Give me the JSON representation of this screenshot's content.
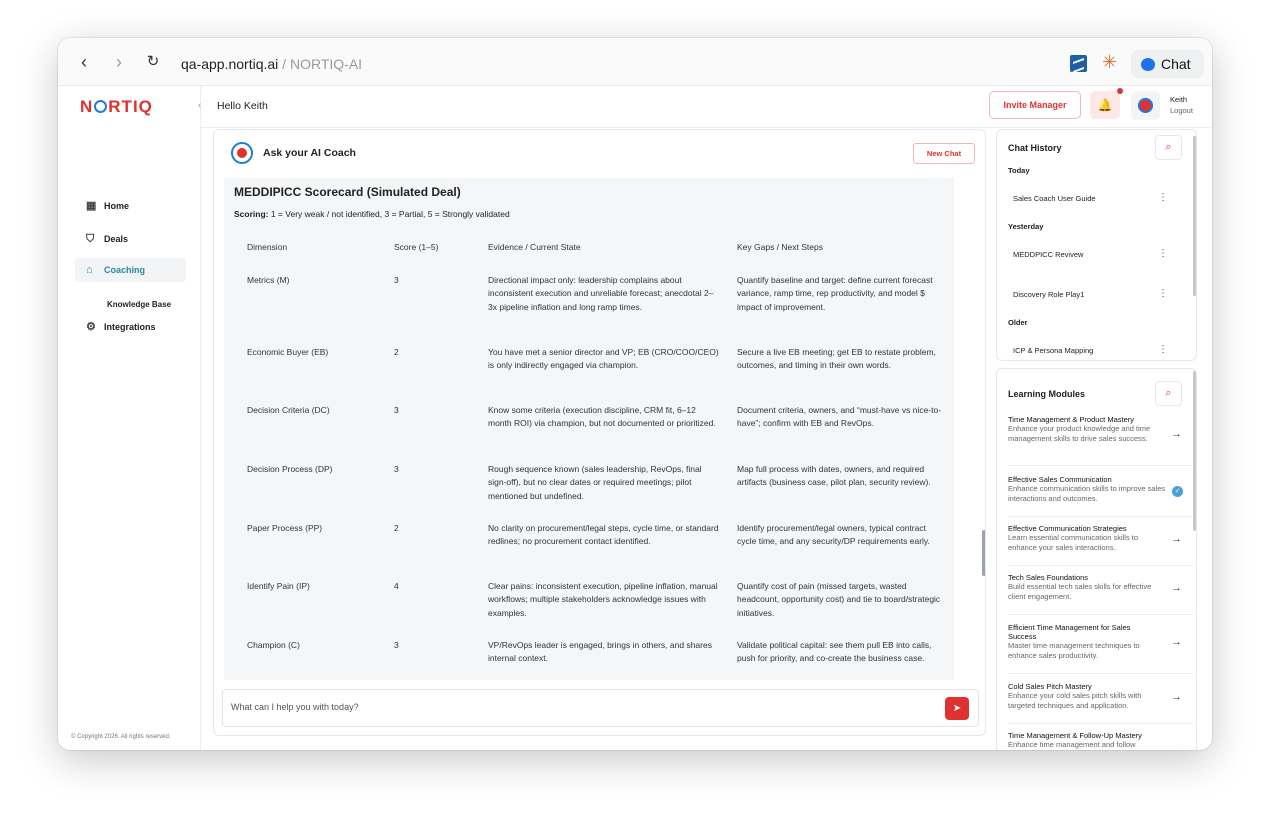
{
  "browser": {
    "url_host": "qa-app.nortiq.ai",
    "url_path": " / NORTIQ-AI",
    "chat_label": "Chat"
  },
  "brand": {
    "logo_pre": "N",
    "logo_post": "RTIQ"
  },
  "sidebar": {
    "items": [
      {
        "label": "Home"
      },
      {
        "label": "Deals"
      },
      {
        "label": "Coaching"
      },
      {
        "label": "Integrations"
      }
    ],
    "sub_item": "Knowledge Base",
    "copyright": "© Copyright 2026. All rights reserved."
  },
  "header": {
    "greeting": "Hello Keith",
    "invite_label": "Invite Manager",
    "user_name": "Keith",
    "logout_label": "Logout"
  },
  "coach": {
    "title": "Ask your AI Coach",
    "new_chat_label": "New Chat",
    "message_title": "MEDDIPICC Scorecard (Simulated Deal)",
    "scoring_label": "Scoring:",
    "scoring_text": " 1 = Very weak / not identified, 3 = Partial, 5 = Strongly validated",
    "table": {
      "headers": [
        "Dimension",
        "Score (1–5)",
        "Evidence / Current State",
        "Key Gaps / Next Steps"
      ],
      "rows": [
        {
          "dimension": "Metrics (M)",
          "score": "3",
          "evidence": "Directional impact only: leadership complains about inconsistent execution and unreliable forecast; anecdotal 2–3x pipeline inflation and long ramp times.",
          "gaps": "Quantify baseline and target: define current forecast variance, ramp time, rep productivity, and model $ impact of improvement."
        },
        {
          "dimension": "Economic Buyer (EB)",
          "score": "2",
          "evidence": "You have met a senior director and VP; EB (CRO/COO/CEO) is only indirectly engaged via champion.",
          "gaps": "Secure a live EB meeting; get EB to restate problem, outcomes, and timing in their own words."
        },
        {
          "dimension": "Decision Criteria (DC)",
          "score": "3",
          "evidence": "Know some criteria (execution discipline, CRM fit, 6–12 month ROI) via champion, but not documented or prioritized.",
          "gaps": "Document criteria, owners, and “must-have vs nice-to-have”; confirm with EB and RevOps."
        },
        {
          "dimension": "Decision Process (DP)",
          "score": "3",
          "evidence": "Rough sequence known (sales leadership, RevOps, final sign-off), but no clear dates or required meetings; pilot mentioned but undefined.",
          "gaps": "Map full process with dates, owners, and required artifacts (business case, pilot plan, security review)."
        },
        {
          "dimension": "Paper Process (PP)",
          "score": "2",
          "evidence": "No clarity on procurement/legal steps, cycle time, or standard redlines; no procurement contact identified.",
          "gaps": "Identify procurement/legal owners, typical contract cycle time, and any security/DP requirements early."
        },
        {
          "dimension": "Identify Pain (IP)",
          "score": "4",
          "evidence": "Clear pains: inconsistent execution, pipeline inflation, manual workflows; multiple stakeholders acknowledge issues with examples.",
          "gaps": "Quantify cost of pain (missed targets, wasted headcount, opportunity cost) and tie to board/strategic initiatives."
        },
        {
          "dimension": "Champion (C)",
          "score": "3",
          "evidence": "VP/RevOps leader is engaged, brings in others, and shares internal context.",
          "gaps": "Validate political capital: see them pull EB into calls, push for priority, and co-create the business case."
        }
      ]
    },
    "input_placeholder": "What can I help you with today?"
  },
  "chat_history": {
    "title": "Chat History",
    "groups": [
      {
        "label": "Today",
        "items": [
          "Sales Coach User Guide"
        ]
      },
      {
        "label": "Yesterday",
        "items": [
          "MEDDPICC Revivew",
          "Discovery Role Play1"
        ]
      },
      {
        "label": "Older",
        "items": [
          "ICP & Persona Mapping"
        ]
      }
    ]
  },
  "learning_modules": {
    "title": "Learning Modules",
    "items": [
      {
        "title": "Time Management & Product Mastery",
        "desc": "Enhance your product knowledge and time management skills to drive sales success."
      },
      {
        "title": "Effective Sales Communication",
        "desc": "Enhance communication skills to improve sales interactions and outcomes."
      },
      {
        "title": "Effective Communication Strategies",
        "desc": "Learn essential communication skills to enhance your sales interactions."
      },
      {
        "title": "Tech Sales Foundations",
        "desc": "Build essential tech sales skills for effective client engagement."
      },
      {
        "title": "Efficient Time Management for Sales Success",
        "desc": "Master time management techniques to enhance sales productivity."
      },
      {
        "title": "Cold Sales Pitch Mastery",
        "desc": "Enhance your cold sales pitch skills with targeted techniques and application."
      },
      {
        "title": "Time Management & Follow-Up Mastery",
        "desc": "Enhance time management and follow"
      }
    ]
  },
  "colors": {
    "brand_red": "#e03131",
    "brand_blue": "#1c7ed6",
    "active_teal": "#2b8a9e"
  }
}
